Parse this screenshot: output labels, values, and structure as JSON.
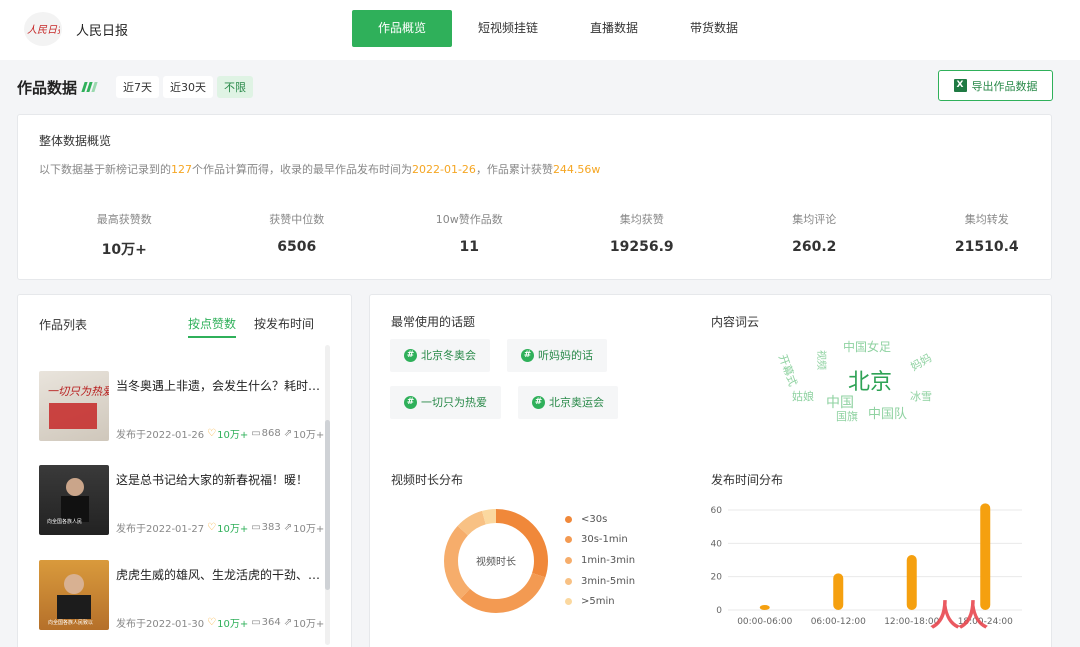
{
  "account": {
    "name": "人民日报",
    "logo_text": "人民日报"
  },
  "nav": {
    "tabs": [
      "作品概览",
      "短视频挂链",
      "直播数据",
      "带货数据"
    ],
    "active": 0
  },
  "toolbar": {
    "title": "作品数据",
    "filters": [
      "近7天",
      "近30天",
      "不限"
    ],
    "active_filter": 2,
    "export_label": "导出作品数据"
  },
  "overview": {
    "title": "整体数据概览",
    "desc_1": "以下数据基于新榜记录到的",
    "works_count": "127",
    "desc_2": "个作品计算而得，收录的最早作品发布时间为",
    "earliest_date": "2022-01-26",
    "desc_3": "，作品累计获赞",
    "total_likes": "244.56w",
    "stats": [
      {
        "label": "最高获赞数",
        "value": "10万+"
      },
      {
        "label": "获赞中位数",
        "value": "6506"
      },
      {
        "label": "10w赞作品数",
        "value": "11"
      },
      {
        "label": "集均获赞",
        "value": "19256.9"
      },
      {
        "label": "集均评论",
        "value": "260.2"
      },
      {
        "label": "集均转发",
        "value": "21510.4"
      }
    ]
  },
  "list": {
    "title": "作品列表",
    "sorts": [
      "按点赞数",
      "按发布时间"
    ],
    "active_sort": 0,
    "items": [
      {
        "title": "当冬奥遇上非遗，会发生什么？耗时…",
        "date": "发布于2022-01-26",
        "likes": "10万+",
        "comments": "868",
        "shares": "10万+",
        "thumb_text": "一切只为热爱"
      },
      {
        "title": "这是总书记给大家的新春祝福！暖！",
        "date": "发布于2022-01-27",
        "likes": "10万+",
        "comments": "383",
        "shares": "10万+",
        "thumb_text": "向全国各族人民"
      },
      {
        "title": "虎虎生威的雄风、生龙活虎的干劲、…",
        "date": "发布于2022-01-30",
        "likes": "10万+",
        "comments": "364",
        "shares": "10万+",
        "thumb_text": "向全国各族人民致以"
      }
    ]
  },
  "topics": {
    "title": "最常使用的话题",
    "items": [
      "北京冬奥会",
      "听妈妈的话",
      "一切只为热爱",
      "北京奥运会"
    ]
  },
  "wordcloud": {
    "title": "内容词云",
    "words": [
      "中国女足",
      "开幕式",
      "视频",
      "北京",
      "妈妈",
      "姑娘",
      "中国",
      "冰雪",
      "国旗",
      "中国队"
    ]
  },
  "duration": {
    "title": "视频时长分布",
    "center_label": "视频时长",
    "legend": [
      "<30s",
      "30s-1min",
      "1min-3min",
      "3min-5min",
      ">5min"
    ],
    "colors": [
      "#f0883a",
      "#f39a52",
      "#f6ad6b",
      "#f8c184",
      "#fbd89f"
    ]
  },
  "chart_data": {
    "type": "bar",
    "title": "发布时间分布",
    "categories": [
      "00:00-06:00",
      "06:00-12:00",
      "12:00-18:00",
      "18:00-24:00"
    ],
    "values": [
      3,
      22,
      33,
      64
    ],
    "ylim": [
      0,
      60
    ],
    "yticks": [
      0,
      20,
      40,
      60
    ],
    "grid": true,
    "color": "#f5a00f"
  },
  "watermark": "人人都是产品经理"
}
